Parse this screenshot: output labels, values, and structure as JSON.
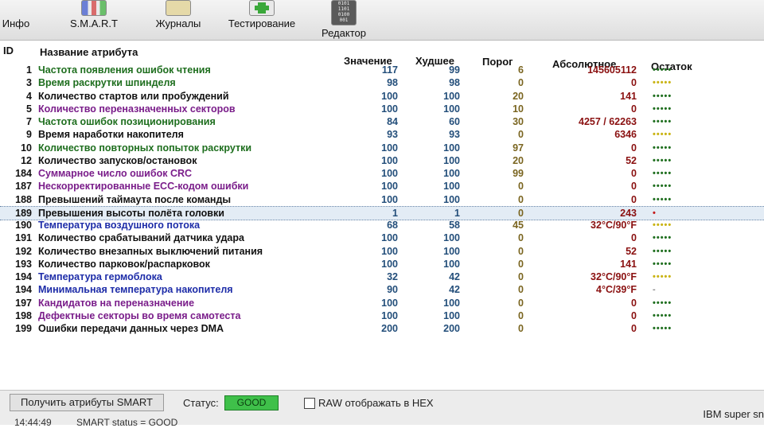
{
  "toolbar": {
    "tabs": [
      {
        "label": "Инфо",
        "icon": "info-icon"
      },
      {
        "label": "S.M.A.R.T",
        "icon": "smart-chart-icon"
      },
      {
        "label": "Журналы",
        "icon": "journal-icon"
      },
      {
        "label": "Тестирование",
        "icon": "test-plus-icon"
      },
      {
        "label": "Редактор",
        "icon": "binary-editor-icon"
      }
    ]
  },
  "table": {
    "headers": {
      "id": "ID",
      "name": "Название атрибута",
      "value": "Значение",
      "worst": "Худшее",
      "threshold": "Порог",
      "raw": "Абсолютное",
      "remaining": "Остаток"
    },
    "rows": [
      {
        "id": "1",
        "name": "Частота появления ошибок чтения",
        "value": "117",
        "worst": "99",
        "threshold": "6",
        "raw": "145605112",
        "rem": "•••••",
        "color": "#1e6e1e",
        "rem_color": "#1e6e1e"
      },
      {
        "id": "3",
        "name": "Время раскрутки шпинделя",
        "value": "98",
        "worst": "98",
        "threshold": "0",
        "raw": "0",
        "rem": "•••••",
        "color": "#1e6e1e",
        "rem_color": "#c9b312"
      },
      {
        "id": "4",
        "name": "Количество стартов или пробуждений",
        "value": "100",
        "worst": "100",
        "threshold": "20",
        "raw": "141",
        "rem": "•••••",
        "color": "#111111",
        "rem_color": "#1e6e1e"
      },
      {
        "id": "5",
        "name": "Количество переназначенных секторов",
        "value": "100",
        "worst": "100",
        "threshold": "10",
        "raw": "0",
        "rem": "•••••",
        "color": "#7a1d8a",
        "rem_color": "#1e6e1e"
      },
      {
        "id": "7",
        "name": "Частота ошибок позиционирования",
        "value": "84",
        "worst": "60",
        "threshold": "30",
        "raw": "4257 / 62263",
        "rem": "•••••",
        "color": "#1e6e1e",
        "rem_color": "#1e6e1e"
      },
      {
        "id": "9",
        "name": "Время наработки накопителя",
        "value": "93",
        "worst": "93",
        "threshold": "0",
        "raw": "6346",
        "rem": "•••••",
        "color": "#111111",
        "rem_color": "#c9b312"
      },
      {
        "id": "10",
        "name": "Количество повторных попыток раскрутки",
        "value": "100",
        "worst": "100",
        "threshold": "97",
        "raw": "0",
        "rem": "•••••",
        "color": "#1e6e1e",
        "rem_color": "#1e6e1e"
      },
      {
        "id": "12",
        "name": "Количество запусков/остановок",
        "value": "100",
        "worst": "100",
        "threshold": "20",
        "raw": "52",
        "rem": "•••••",
        "color": "#111111",
        "rem_color": "#1e6e1e"
      },
      {
        "id": "184",
        "name": "Суммарное число ошибок CRC",
        "value": "100",
        "worst": "100",
        "threshold": "99",
        "raw": "0",
        "rem": "•••••",
        "color": "#7a1d8a",
        "rem_color": "#1e6e1e"
      },
      {
        "id": "187",
        "name": "Нескорректированные ECC-кодом ошибки",
        "value": "100",
        "worst": "100",
        "threshold": "0",
        "raw": "0",
        "rem": "•••••",
        "color": "#7a1d8a",
        "rem_color": "#1e6e1e"
      },
      {
        "id": "188",
        "name": "Превышений таймаута после команды",
        "value": "100",
        "worst": "100",
        "threshold": "0",
        "raw": "0",
        "rem": "•••••",
        "color": "#111111",
        "rem_color": "#1e6e1e"
      },
      {
        "id": "189",
        "name": "Превышения высоты полёта головки",
        "value": "1",
        "worst": "1",
        "threshold": "0",
        "raw": "243",
        "rem": "•",
        "color": "#111111",
        "rem_color": "#c41a1a"
      },
      {
        "id": "190",
        "name": "Температура воздушного потока",
        "value": "68",
        "worst": "58",
        "threshold": "45",
        "raw": "32°C/90°F",
        "rem": "•••••",
        "color": "#1d2ca8",
        "rem_color": "#c9b312"
      },
      {
        "id": "191",
        "name": "Количество срабатываний датчика удара",
        "value": "100",
        "worst": "100",
        "threshold": "0",
        "raw": "0",
        "rem": "•••••",
        "color": "#111111",
        "rem_color": "#1e6e1e"
      },
      {
        "id": "192",
        "name": "Количество внезапных выключений питания",
        "value": "100",
        "worst": "100",
        "threshold": "0",
        "raw": "52",
        "rem": "•••••",
        "color": "#111111",
        "rem_color": "#1e6e1e"
      },
      {
        "id": "193",
        "name": "Количество парковок/распарковок",
        "value": "100",
        "worst": "100",
        "threshold": "0",
        "raw": "141",
        "rem": "•••••",
        "color": "#111111",
        "rem_color": "#1e6e1e"
      },
      {
        "id": "194",
        "name": "Температура гермоблока",
        "value": "32",
        "worst": "42",
        "threshold": "0",
        "raw": "32°C/90°F",
        "rem": "•••••",
        "color": "#1d2ca8",
        "rem_color": "#c9b312"
      },
      {
        "id": "194",
        "name": "Минимальная температура накопителя",
        "value": "90",
        "worst": "42",
        "threshold": "0",
        "raw": "4°C/39°F",
        "rem": "-",
        "color": "#1d2ca8",
        "rem_color": "#8a8a8a"
      },
      {
        "id": "197",
        "name": "Кандидатов на переназначение",
        "value": "100",
        "worst": "100",
        "threshold": "0",
        "raw": "0",
        "rem": "•••••",
        "color": "#7a1d8a",
        "rem_color": "#1e6e1e"
      },
      {
        "id": "198",
        "name": "Дефектные секторы во время самотеста",
        "value": "100",
        "worst": "100",
        "threshold": "0",
        "raw": "0",
        "rem": "•••••",
        "color": "#7a1d8a",
        "rem_color": "#1e6e1e"
      },
      {
        "id": "199",
        "name": "Ошибки передачи данных через DMA",
        "value": "200",
        "worst": "200",
        "threshold": "0",
        "raw": "0",
        "rem": "•••••",
        "color": "#111111",
        "rem_color": "#1e6e1e"
      }
    ]
  },
  "bottom": {
    "get_attrs_label": "Получить атрибуты SMART",
    "status_label": "Статус:",
    "status_value": "GOOD",
    "raw_hex_label": "RAW отображать в HEX",
    "brand": "IBM super sn"
  },
  "statusline": {
    "time": "14:44:49",
    "text": "SMART status = GOOD"
  }
}
